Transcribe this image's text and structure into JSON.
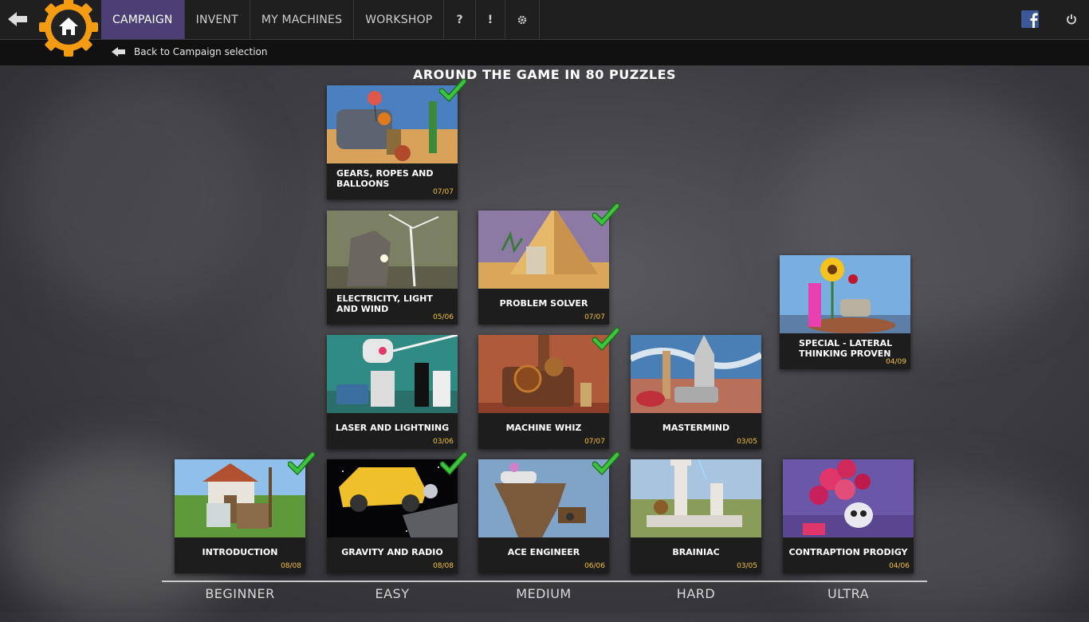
{
  "nav": {
    "back_icon": "back-arrow-icon",
    "home_icon": "home-icon",
    "tabs": [
      {
        "label": "CAMPAIGN",
        "active": true
      },
      {
        "label": "INVENT",
        "active": false
      },
      {
        "label": "MY MACHINES",
        "active": false
      },
      {
        "label": "WORKSHOP",
        "active": false
      }
    ],
    "help": "?",
    "alert": "!",
    "settings_icon": "gear-icon",
    "facebook_icon": "facebook-icon",
    "power_icon": "power-icon"
  },
  "subnav": {
    "back_label": "Back to Campaign selection"
  },
  "title": "AROUND THE GAME IN 80 PUZZLES",
  "colors": {
    "accent": "#4c3f76",
    "gear": "#f39c12",
    "count": "#f3c234",
    "check": "#3cc43c"
  },
  "chapters": [
    {
      "id": "gears",
      "label": "GEARS, ROPES AND BALLOONS",
      "count": "07/07",
      "completed": true
    },
    {
      "id": "electricity",
      "label": "ELECTRICITY, LIGHT AND WIND",
      "count": "05/06",
      "completed": false
    },
    {
      "id": "problem",
      "label": "PROBLEM SOLVER",
      "count": "07/07",
      "completed": true
    },
    {
      "id": "special",
      "label": "SPECIAL - LATERAL THINKING PROVEN",
      "count": "04/09",
      "completed": false
    },
    {
      "id": "laser",
      "label": "LASER AND LIGHTNING",
      "count": "03/06",
      "completed": false
    },
    {
      "id": "machine",
      "label": "MACHINE WHIZ",
      "count": "07/07",
      "completed": true
    },
    {
      "id": "mastermind",
      "label": "MASTERMIND",
      "count": "03/05",
      "completed": false
    },
    {
      "id": "intro",
      "label": "INTRODUCTION",
      "count": "08/08",
      "completed": true
    },
    {
      "id": "gravity",
      "label": "GRAVITY AND RADIO",
      "count": "08/08",
      "completed": true
    },
    {
      "id": "ace",
      "label": "ACE ENGINEER",
      "count": "06/06",
      "completed": true
    },
    {
      "id": "brainiac",
      "label": "BRAINIAC",
      "count": "03/05",
      "completed": false
    },
    {
      "id": "prodigy",
      "label": "CONTRAPTION PRODIGY",
      "count": "04/06",
      "completed": false
    }
  ],
  "difficulties": [
    "BEGINNER",
    "EASY",
    "MEDIUM",
    "HARD",
    "ULTRA"
  ]
}
